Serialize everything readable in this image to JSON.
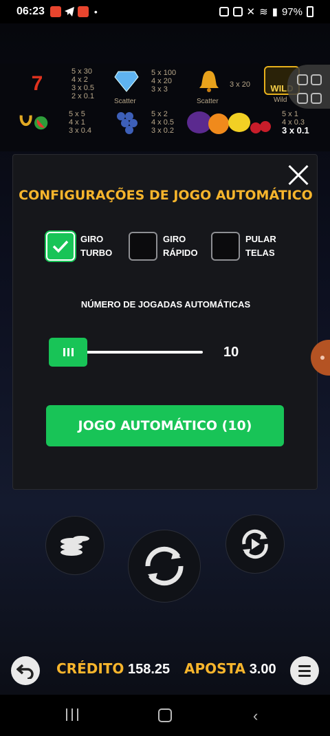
{
  "status_bar": {
    "time": "06:23",
    "battery": "97%"
  },
  "paytable": {
    "seven": {
      "lines": [
        "5 x 30",
        "4 x 2",
        "3 x 0.5",
        "2 x 0.1"
      ]
    },
    "diamond": {
      "lines": [
        "5 x 100",
        "4 x 20",
        "3 x 3"
      ],
      "caption": "Scatter"
    },
    "bell": {
      "lines": [
        "3 x 20"
      ],
      "caption": "Scatter"
    },
    "wild": {
      "caption": "Wild",
      "badge": "WILD"
    },
    "horseshoe": {
      "lines": [
        "5 x 5",
        "4 x 1",
        "3 x 0.4"
      ]
    },
    "grapes": {
      "lines": [
        "5 x 2",
        "4 x 0.5",
        "3 x 0.2"
      ]
    },
    "fruits": {
      "lines": [
        "5 x 1",
        "4 x 0.3",
        "3 x 0.1"
      ]
    }
  },
  "dialog": {
    "title": "CONFIGURAÇÕES DE JOGO AUTOMÁTICO",
    "options": [
      {
        "line1": "GIRO",
        "line2": "TURBO",
        "checked": true
      },
      {
        "line1": "GIRO",
        "line2": "RÁPIDO",
        "checked": false
      },
      {
        "line1": "PULAR",
        "line2": "TELAS",
        "checked": false
      }
    ],
    "spins_label": "NÚMERO DE JOGADAS AUTOMÁTICAS",
    "spins_value": "10",
    "start_button": "JOGO AUTOMÁTICO (10)"
  },
  "bottom": {
    "credit_label": "CRÉDITO",
    "credit_value": "158.25",
    "bet_label": "APOSTA",
    "bet_value": "3.00"
  },
  "colors": {
    "accent": "#f7b52c",
    "green": "#18c457",
    "panel": "#16171b"
  },
  "icons": [
    "back-icon",
    "menu-icon",
    "coins-icon",
    "spin-icon",
    "autoplay-icon",
    "close-icon",
    "check-icon"
  ]
}
